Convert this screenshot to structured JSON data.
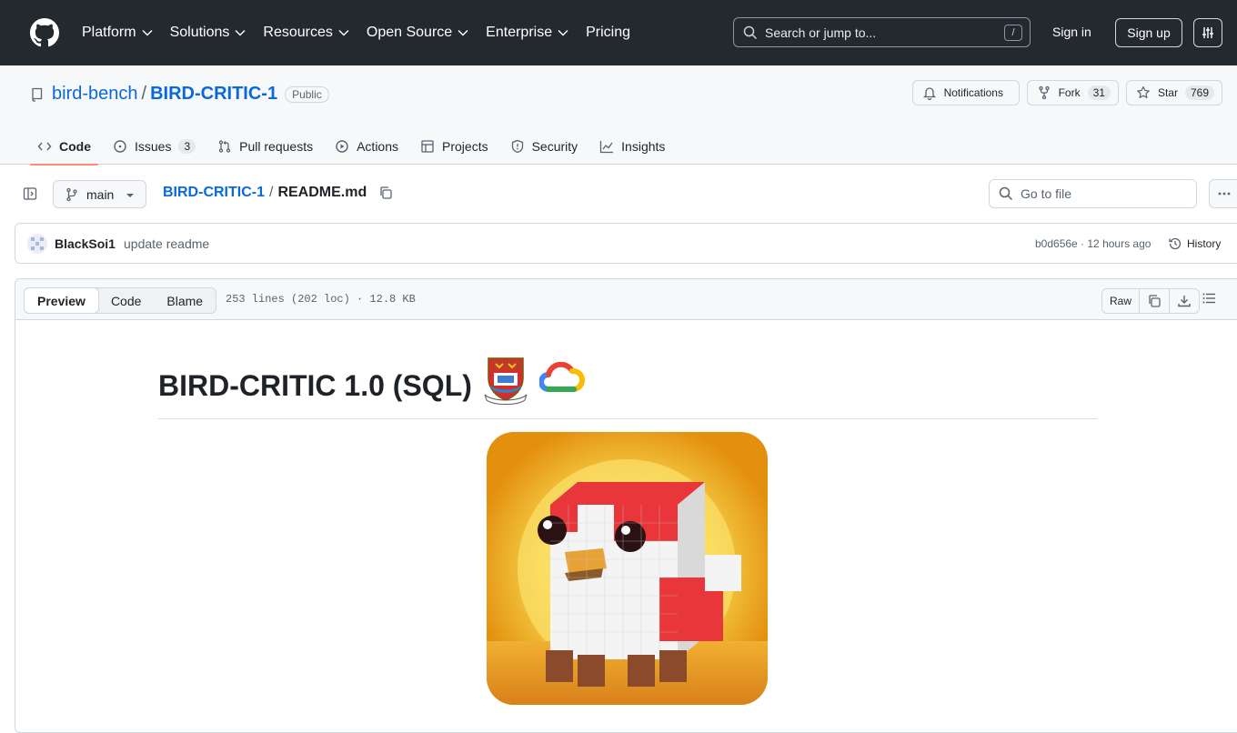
{
  "header": {
    "nav": [
      {
        "label": "Platform",
        "has_menu": true
      },
      {
        "label": "Solutions",
        "has_menu": true
      },
      {
        "label": "Resources",
        "has_menu": true
      },
      {
        "label": "Open Source",
        "has_menu": true
      },
      {
        "label": "Enterprise",
        "has_menu": true
      },
      {
        "label": "Pricing",
        "has_menu": false
      }
    ],
    "search_placeholder": "Search or jump to...",
    "search_shortcut": "/",
    "sign_in": "Sign in",
    "sign_up": "Sign up"
  },
  "repo": {
    "owner": "bird-bench",
    "name": "BIRD-CRITIC-1",
    "visibility": "Public",
    "notifications_label": "Notifications",
    "fork_label": "Fork",
    "fork_count": "31",
    "star_label": "Star",
    "star_count": "769",
    "tabs": [
      {
        "label": "Code",
        "icon": "code-icon",
        "active": true,
        "count": ""
      },
      {
        "label": "Issues",
        "icon": "issue-icon",
        "active": false,
        "count": "3"
      },
      {
        "label": "Pull requests",
        "icon": "pull-request-icon",
        "active": false,
        "count": ""
      },
      {
        "label": "Actions",
        "icon": "play-icon",
        "active": false,
        "count": ""
      },
      {
        "label": "Projects",
        "icon": "table-icon",
        "active": false,
        "count": ""
      },
      {
        "label": "Security",
        "icon": "shield-icon",
        "active": false,
        "count": ""
      },
      {
        "label": "Insights",
        "icon": "graph-icon",
        "active": false,
        "count": ""
      }
    ]
  },
  "filebar": {
    "branch": "main",
    "breadcrumb_repo": "BIRD-CRITIC-1",
    "breadcrumb_sep": "/",
    "breadcrumb_file": "README.md",
    "goto_placeholder": "Go to file"
  },
  "commit": {
    "author": "BlackSoi1",
    "message": "update readme",
    "meta": "b0d656e · 12 hours ago",
    "history_label": "History"
  },
  "viewer": {
    "modes": [
      "Preview",
      "Code",
      "Blame"
    ],
    "active_mode": "Preview",
    "stats": "253 lines (202 loc) · 12.8 KB",
    "raw_label": "Raw"
  },
  "readme": {
    "title": "BIRD-CRITIC 1.0 (SQL)"
  },
  "colors": {
    "header_bg": "#24292f",
    "link": "#0969da",
    "tab_underline": "#fd8c73"
  }
}
